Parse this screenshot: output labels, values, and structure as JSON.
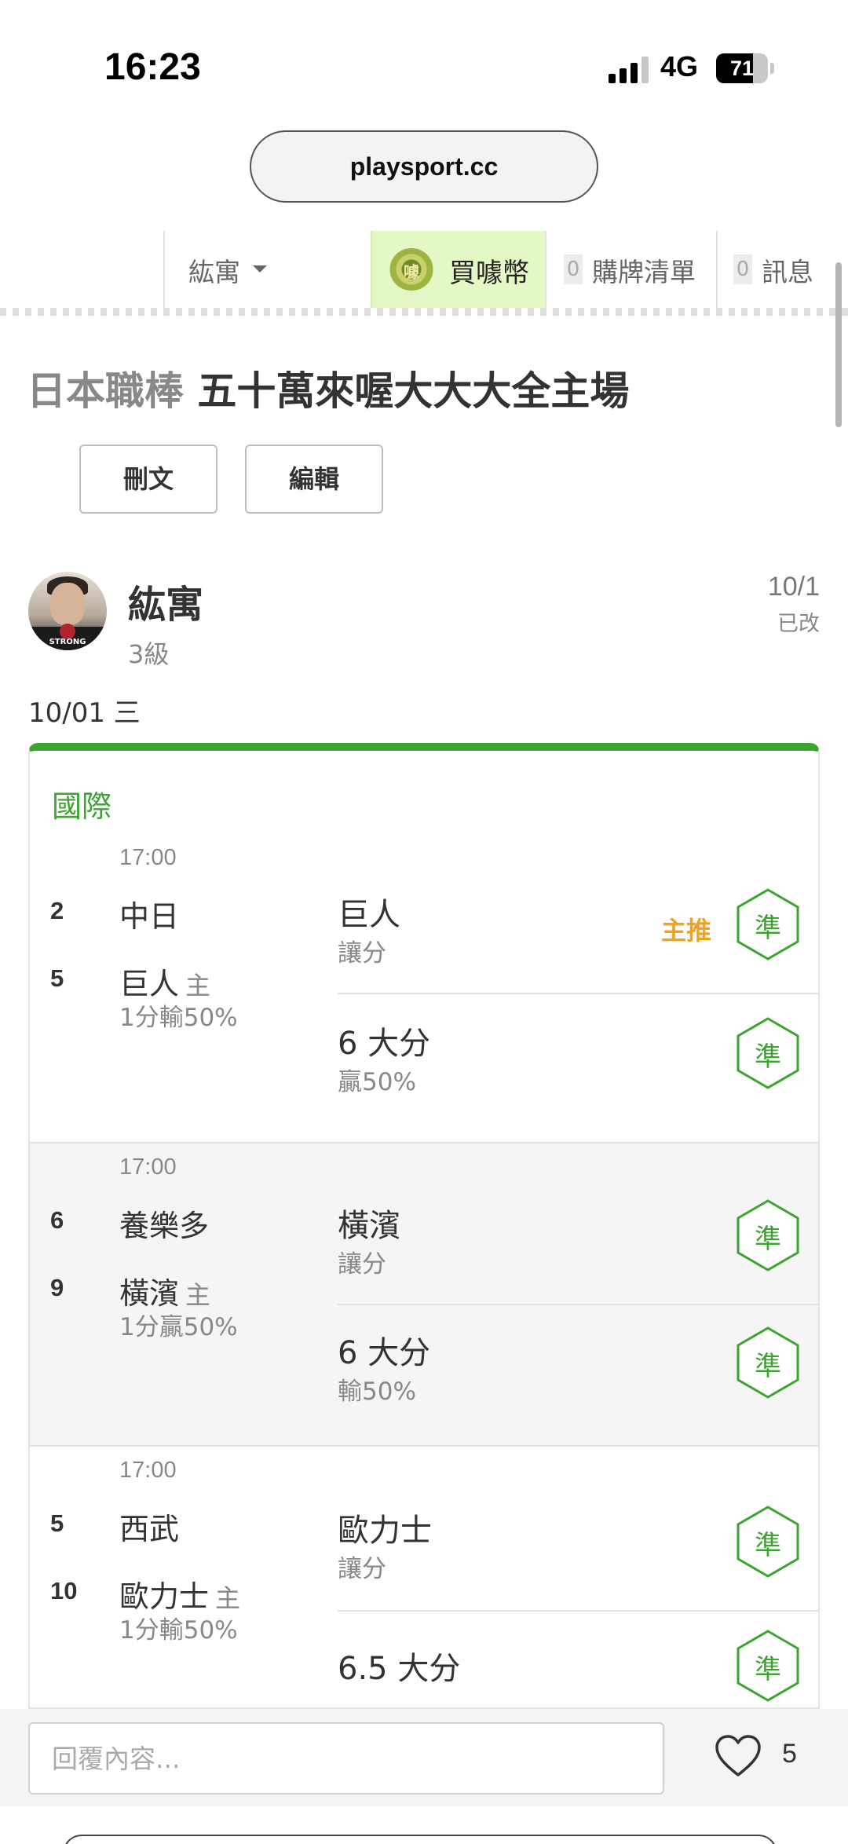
{
  "status_bar": {
    "time": "16:23",
    "network": "4G",
    "battery": "71",
    "battery_level": 0.71
  },
  "browser": {
    "url": "playsport.cc"
  },
  "topnav": {
    "user_menu": "紘寓",
    "coin_icon_text": "噱",
    "coin_label": "買噱幣",
    "cart_count": "0",
    "cart_label": "購牌清單",
    "msg_count": "0",
    "msg_label": "訊息"
  },
  "post": {
    "league": "日本職棒",
    "title": "五十萬來喔大大大全主場",
    "delete_label": "刪文",
    "edit_label": "編輯",
    "author": {
      "name": "紘寓",
      "level": "3級",
      "avatar_text": "STRONG"
    },
    "date": "10/1",
    "edited": "已改",
    "game_date": "10/01 三"
  },
  "picks": {
    "league_label": "國際",
    "home_tag": "主",
    "badge_label": "準",
    "featured_label": "主推",
    "games": [
      {
        "time": "17:00",
        "away": {
          "rank": "2",
          "name": "中日"
        },
        "home": {
          "rank": "5",
          "name": "巨人"
        },
        "result": "1分輸50%",
        "spread": {
          "team": "巨人",
          "type": "讓分"
        },
        "total": {
          "label": "6 大分",
          "result": "贏50%"
        }
      },
      {
        "time": "17:00",
        "away": {
          "rank": "6",
          "name": "養樂多"
        },
        "home": {
          "rank": "9",
          "name": "橫濱"
        },
        "result": "1分贏50%",
        "spread": {
          "team": "橫濱",
          "type": "讓分"
        },
        "total": {
          "label": "6 大分",
          "result": "輸50%"
        }
      },
      {
        "time": "17:00",
        "away": {
          "rank": "5",
          "name": "西武"
        },
        "home": {
          "rank": "10",
          "name": "歐力士"
        },
        "result": "1分輸50%",
        "spread": {
          "team": "歐力士",
          "type": "讓分"
        },
        "total": {
          "label": "6.5 大分",
          "result": ""
        }
      }
    ]
  },
  "reply": {
    "placeholder": "回覆內容...",
    "like_count": "5"
  },
  "colors": {
    "accent_green": "#3aa42f",
    "featured_orange": "#f0a21e",
    "coin_bg": "#e4f8c6"
  }
}
